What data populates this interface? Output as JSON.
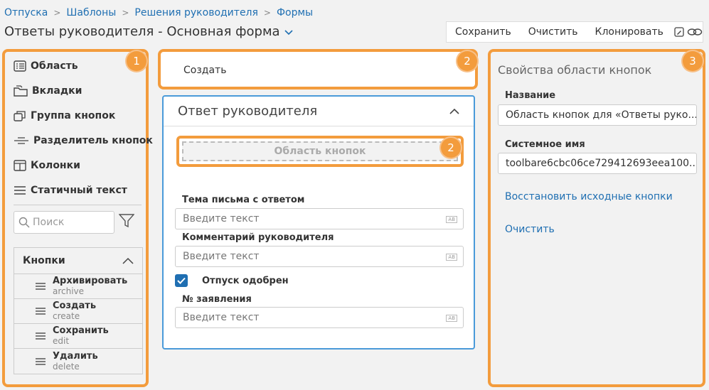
{
  "breadcrumb": [
    "Отпуска",
    "Шаблоны",
    "Решения руководителя",
    "Формы"
  ],
  "title": "Ответы руководителя - Основная форма",
  "toolbar": {
    "save": "Сохранить",
    "clear": "Очистить",
    "clone": "Клонировать"
  },
  "badges": {
    "left": "1",
    "middle_top": "2",
    "middle_area": "2",
    "right": "3"
  },
  "elements": [
    "Область",
    "Вкладки",
    "Группа кнопок",
    "Разделитель кнопок",
    "Колонки",
    "Статичный текст"
  ],
  "search": {
    "placeholder": "Поиск"
  },
  "buttons_group": {
    "title": "Кнопки",
    "items": [
      {
        "label": "Архивировать",
        "code": "archive"
      },
      {
        "label": "Создать",
        "code": "create"
      },
      {
        "label": "Сохранить",
        "code": "edit"
      },
      {
        "label": "Удалить",
        "code": "delete"
      }
    ]
  },
  "toolbar_area": {
    "create": "Создать"
  },
  "card": {
    "title": "Ответ руководителя",
    "button_area": "Область кнопок",
    "fields": [
      {
        "label": "Тема письма с ответом",
        "placeholder": "Введите текст"
      },
      {
        "label": "Комментарий руководителя",
        "placeholder": "Введите текст"
      },
      {
        "label": "№ заявления",
        "placeholder": "Введите текст"
      }
    ],
    "checkbox": "Отпуск одобрен",
    "input_marker": "AB"
  },
  "props": {
    "title": "Свойства области кнопок",
    "name_label": "Название",
    "name_value": "Область кнопок для «Ответы руко...",
    "sys_label": "Системное имя",
    "sys_value": "toolbare6cbc06ce729412693eea100...",
    "restore": "Восстановить исходные кнопки",
    "clear": "Очистить"
  },
  "colors": {
    "accent": "#1f6fb2",
    "highlight": "#f39c3d",
    "card_border": "#4a9ad9"
  }
}
